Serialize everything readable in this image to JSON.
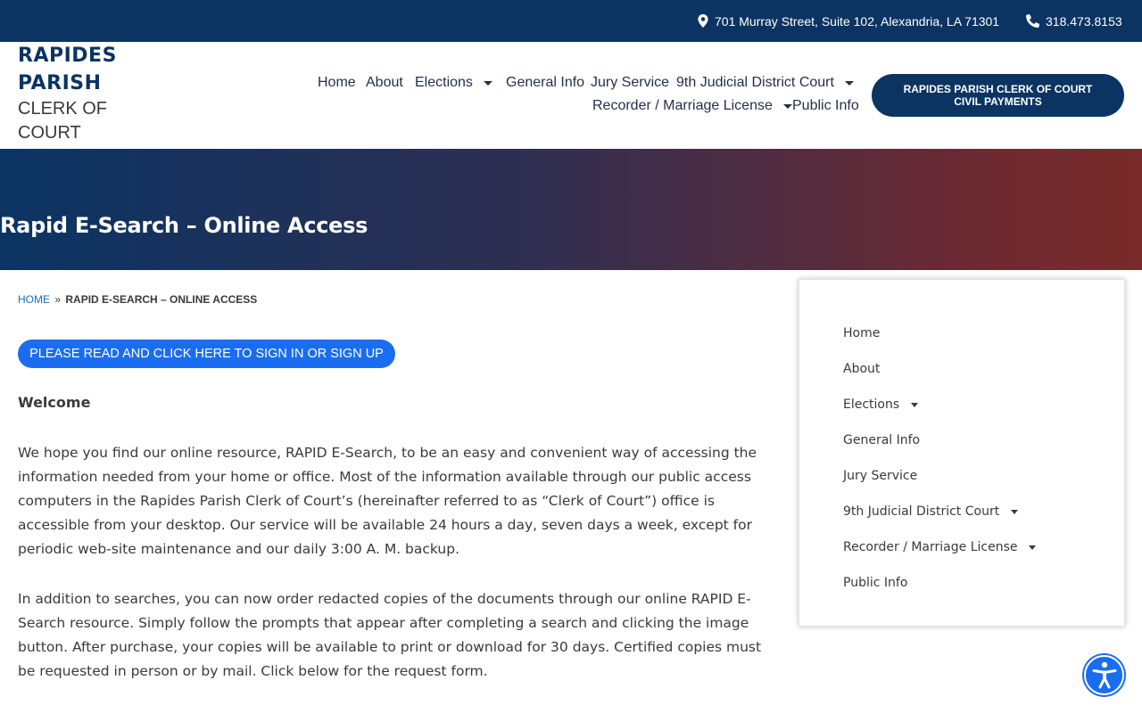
{
  "topbar": {
    "address": "701 Murray Street, Suite 102, Alexandria, LA 71301",
    "phone": "318.473.8153",
    "address_icon": "map-pin-icon",
    "phone_icon": "phone-icon"
  },
  "logo": {
    "line1": "RAPIDES",
    "line2": "PARISH",
    "line3": "CLERK OF",
    "line4": "COURT"
  },
  "nav": {
    "home": "Home",
    "about": "About",
    "elections": "Elections",
    "general_info": "General Info",
    "jury_service": "Jury Service",
    "district_court": "9th Judicial District Court",
    "recorder": "Recorder / Marriage License",
    "public_info": "Public Info"
  },
  "pay_button": "RAPIDES PARISH CLERK OF COURT CIVIL PAYMENTS",
  "hero": {
    "title": "Rapid E-Search – Online Access"
  },
  "breadcrumb": {
    "home": "HOME",
    "separator": "»",
    "current": "RAPID E-SEARCH – ONLINE ACCESS"
  },
  "signin_button": "PLEASE READ AND CLICK HERE TO SIGN IN OR SIGN UP",
  "content": {
    "welcome": "Welcome",
    "paragraph1": "We hope you find our online resource, RAPID E-Search, to be an easy and convenient way of accessing the information needed from your home or office. Most of the information available through our public access computers in the Rapides Parish Clerk of Court’s (hereinafter referred to as “Clerk of Court”) office is accessible from your desktop. Our service will be available 24 hours a day, seven days a week, except for periodic web-site maintenance and our daily 3:00 A. M. backup.",
    "paragraph2": "In addition to searches, you can now order redacted copies of the documents through our online RAPID E-Search resource. Simply follow the prompts that appear after completing a search and clicking the image button. After purchase, your copies will be available to print or download for 30 days. Certified copies must be requested in person or by mail. Click below for the request form."
  },
  "sidebar": {
    "items": [
      {
        "label": "Home",
        "has_submenu": false
      },
      {
        "label": "About",
        "has_submenu": false
      },
      {
        "label": "Elections",
        "has_submenu": true
      },
      {
        "label": "General Info",
        "has_submenu": false
      },
      {
        "label": "Jury Service",
        "has_submenu": false
      },
      {
        "label": "9th Judicial District Court",
        "has_submenu": true
      },
      {
        "label": "Recorder / Marriage License",
        "has_submenu": true
      },
      {
        "label": "Public Info",
        "has_submenu": false
      }
    ]
  },
  "accessibility_icon": "accessibility-icon",
  "colors": {
    "primary_navy": "#0b3463",
    "accent_blue": "#1a6df0",
    "hero_red": "#7a2a2a",
    "link_blue": "#1b6ec2"
  }
}
